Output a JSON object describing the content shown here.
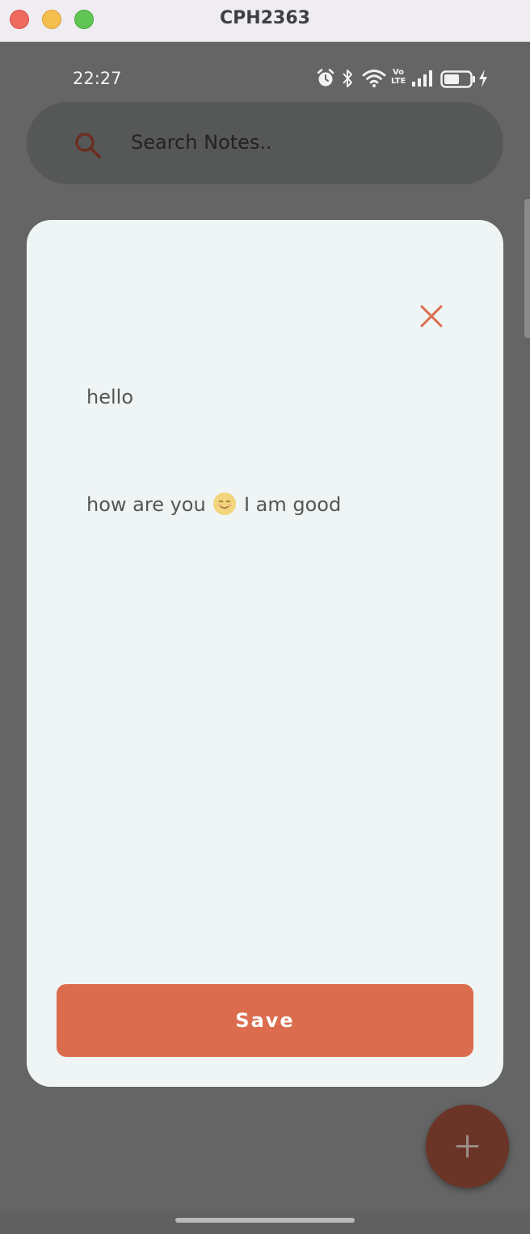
{
  "window": {
    "title": "CPH2363"
  },
  "status_bar": {
    "time": "22:27",
    "icons": [
      "alarm-icon",
      "bluetooth-icon",
      "wifi-icon",
      "volte-icon",
      "signal-icon",
      "battery-icon",
      "charging-icon"
    ],
    "volte_label_top": "Vo",
    "volte_label_bottom": "LTE"
  },
  "search": {
    "placeholder": "Search Notes.."
  },
  "note_editor": {
    "title": "hello",
    "body_before": "how are you ",
    "body_after": " I am good",
    "save_label": "Save"
  },
  "colors": {
    "accent": "#db6d4e",
    "card": "#eff4f4",
    "backdrop": "#646564",
    "fab": "#6a3427"
  }
}
